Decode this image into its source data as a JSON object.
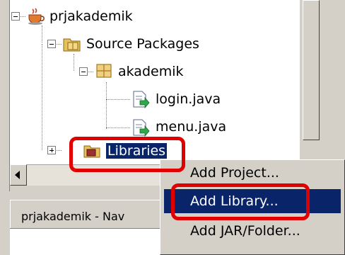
{
  "projects_tree": {
    "project": {
      "label": "prjakademik"
    },
    "source_packages": {
      "label": "Source Packages"
    },
    "package": {
      "label": "akademik"
    },
    "files": [
      {
        "label": "login.java"
      },
      {
        "label": "menu.java"
      }
    ],
    "libraries": {
      "label": "Libraries"
    }
  },
  "navigator_tab": {
    "label": "prjakademik - Nav"
  },
  "context_menu": {
    "items": [
      {
        "label": "Add Project..."
      },
      {
        "label": "Add Library..."
      },
      {
        "label": "Add JAR/Folder..."
      }
    ],
    "highlighted_index": 1
  },
  "colors": {
    "highlight": "#0a246a",
    "annotation_red": "#e00000",
    "panel_gray": "#d4d0c8"
  }
}
